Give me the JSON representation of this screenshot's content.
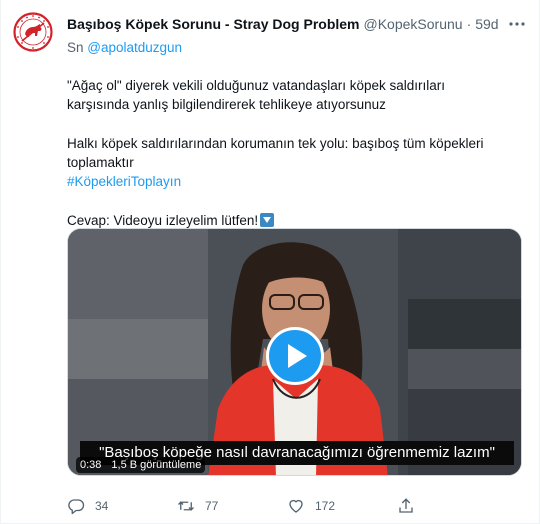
{
  "tweet": {
    "display_name": "Başıboş Köpek Sorunu - Stray Dog Problem",
    "handle": "@KopekSorunu",
    "separator": "·",
    "time": "59d",
    "reply_prefix": "Sn",
    "reply_mention": "@apolatduzgun",
    "paragraph1": "\"Ağaç ol\" diyerek vekili olduğunuz vatandaşları köpek saldırıları karşısında yanlış bilgilendirerek tehlikeye atıyorsunuz",
    "paragraph2": "Halkı köpek saldırılarından korumanın tek yolu: başıboş tüm köpekleri toplamaktır",
    "hashtag": "#KöpekleriToplayın",
    "paragraph3": "Cevap: Videoyu izleyelim lütfen!",
    "paragraph3_emoji": "down-arrow-emoji"
  },
  "video": {
    "subtitle": "\"Başıboş köpeğe nasıl davranacağımızı öğrenmemiz lazım\"",
    "duration": "0:38",
    "views": "1,5 B görüntüleme",
    "play_icon": "play-icon"
  },
  "actions": {
    "reply_count": "34",
    "retweet_count": "77",
    "like_count": "172"
  },
  "colors": {
    "accent": "#1d9bf0",
    "muted": "#536471",
    "text": "#0f1419",
    "logo_red": "#d2232a"
  }
}
